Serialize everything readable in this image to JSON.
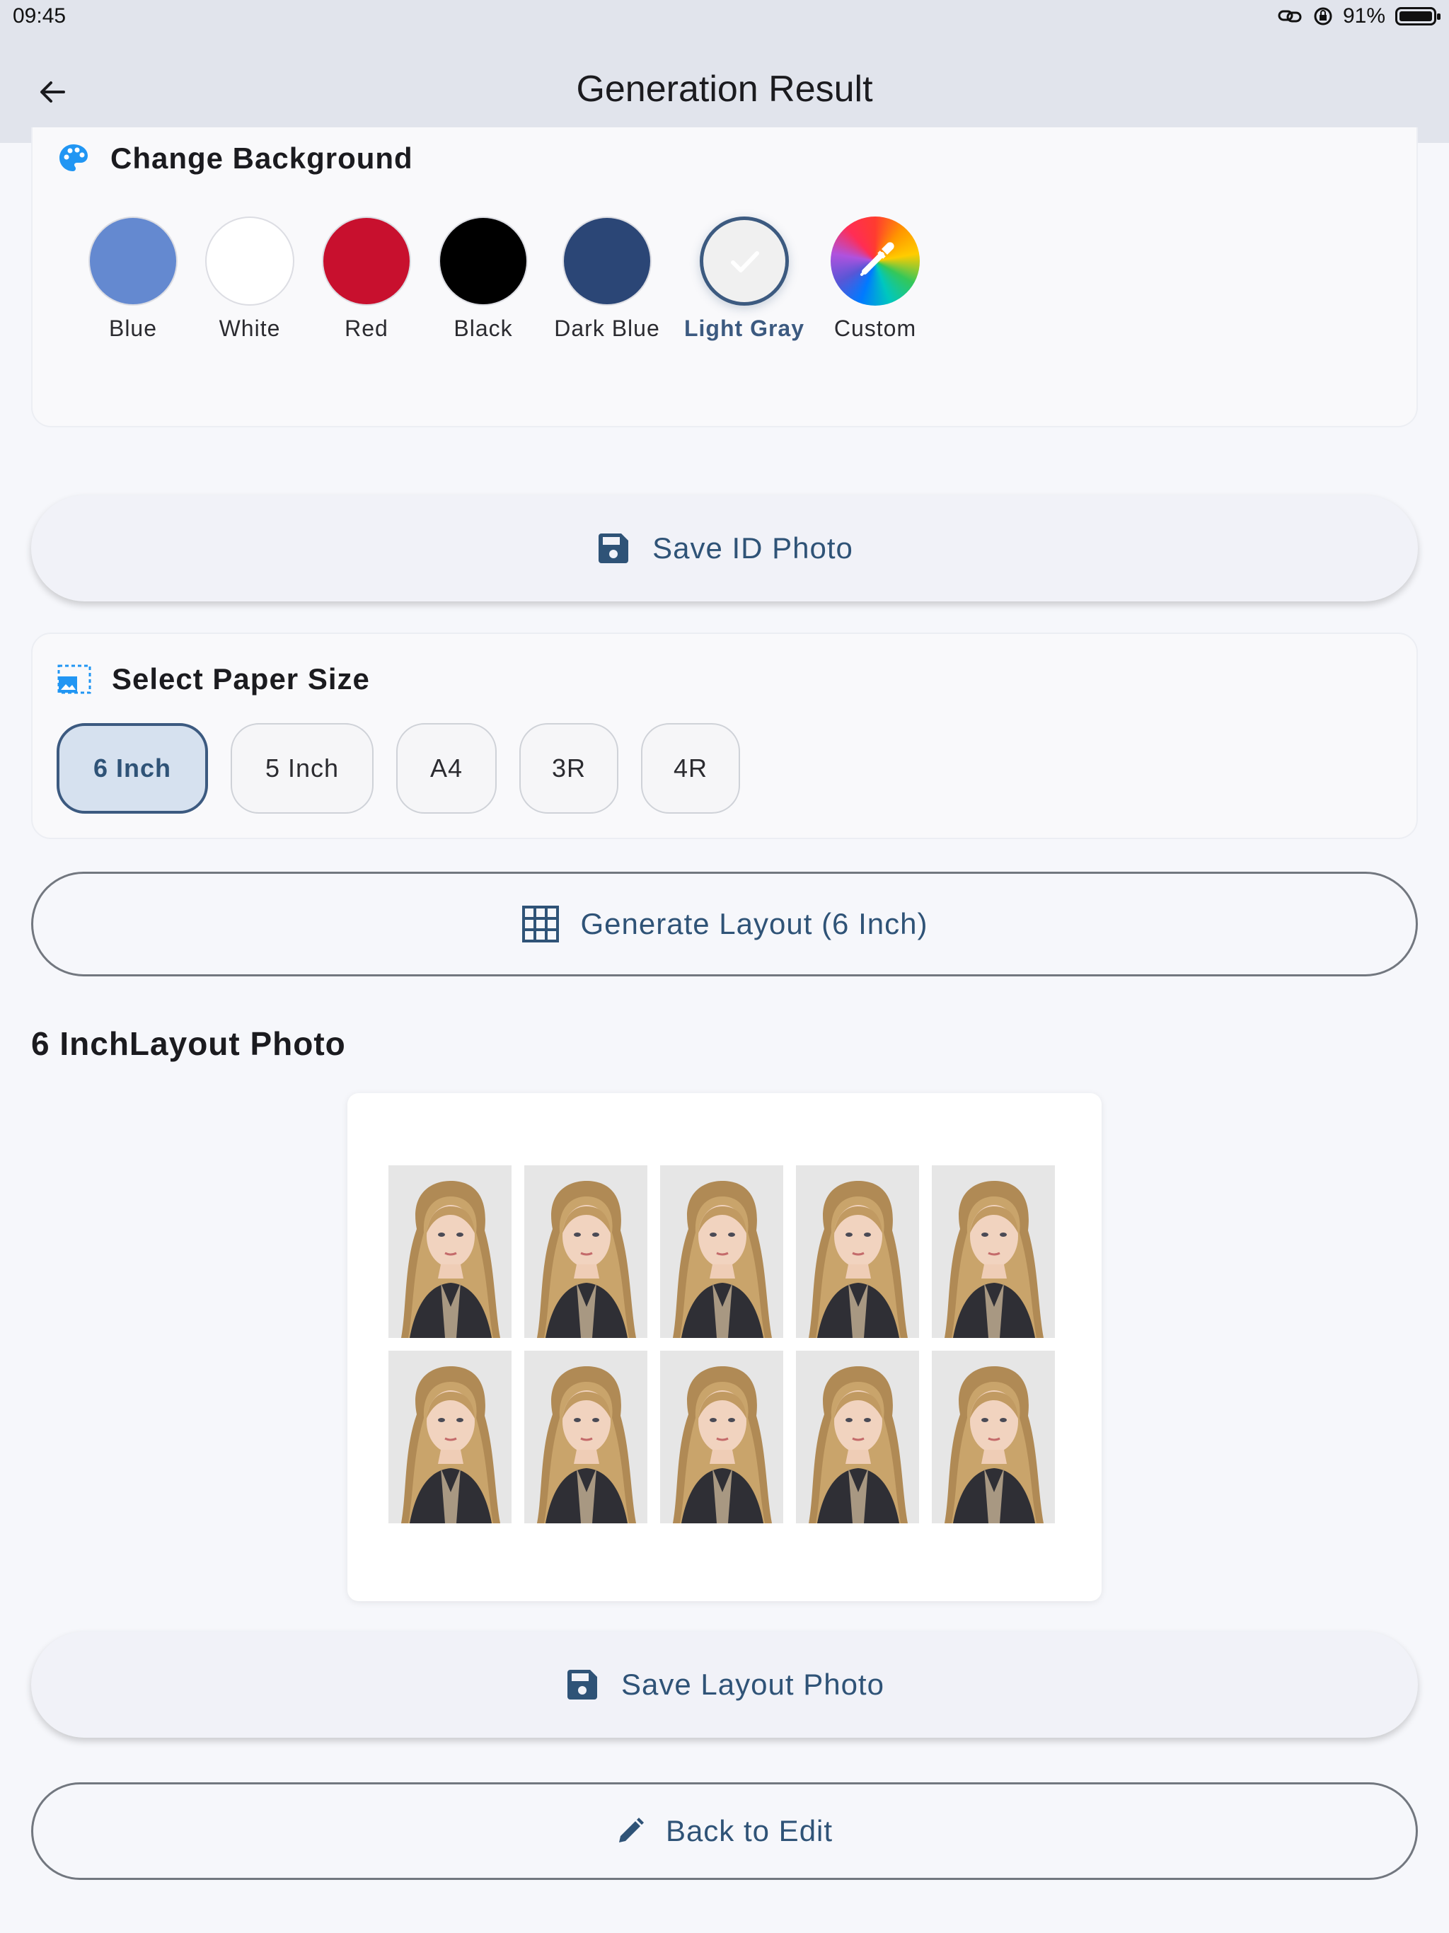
{
  "status_bar": {
    "time": "09:45",
    "battery": "91%"
  },
  "app_bar": {
    "title": "Generation Result"
  },
  "background": {
    "heading": "Change Background",
    "options": [
      {
        "label": "Blue",
        "color": "#6489d0"
      },
      {
        "label": "White",
        "color": "#ffffff"
      },
      {
        "label": "Red",
        "color": "#c8102e"
      },
      {
        "label": "Black",
        "color": "#000000"
      },
      {
        "label": "Dark Blue",
        "color": "#2b4676"
      },
      {
        "label": "Light Gray",
        "color": "#f0f0f0",
        "selected": true
      },
      {
        "label": "Custom",
        "color": "rainbow"
      }
    ]
  },
  "save_id": {
    "label": "Save ID Photo"
  },
  "paper": {
    "heading": "Select Paper Size",
    "options": [
      "6 Inch",
      "5 Inch",
      "A4",
      "3R",
      "4R"
    ],
    "selected": "6 Inch"
  },
  "generate": {
    "label": "Generate Layout (6 Inch)"
  },
  "layout": {
    "title": "6 InchLayout Photo"
  },
  "save_layout": {
    "label": "Save Layout Photo"
  },
  "back_edit": {
    "label": "Back to Edit"
  },
  "colors": {
    "accent": "#2f5377",
    "selected_border": "#3c5a80"
  }
}
